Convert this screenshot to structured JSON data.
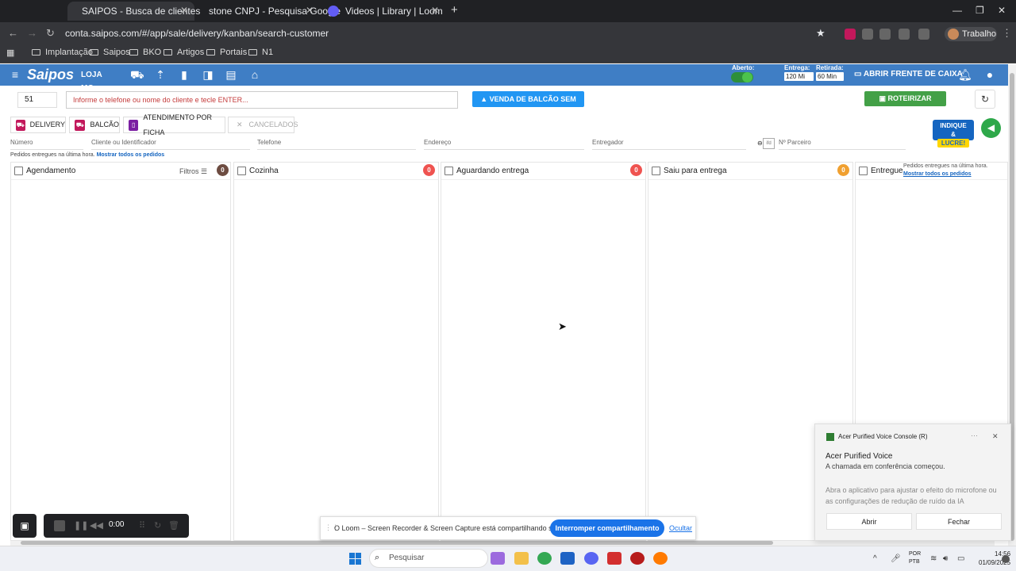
{
  "browser": {
    "tabs": [
      {
        "title": "SAIPOS - Busca de clientes",
        "active": true
      },
      {
        "title": "stone CNPJ - Pesquisa Google",
        "active": false
      },
      {
        "title": "Videos | Library | Loom",
        "active": false
      }
    ],
    "url": "conta.saipos.com/#/app/sale/delivery/kanban/search-customer",
    "profile": "Trabalho",
    "bookmarks": [
      "Implantação",
      "Saipos",
      "BKO",
      "Artigos",
      "Portais",
      "N1"
    ]
  },
  "app": {
    "logo": "Saipos",
    "store": "LOJA MO...",
    "aberto_label": "Aberto:",
    "entrega_label": "Entrega:",
    "entrega_value": "120 Mi",
    "retirada_label": "Retirada:",
    "retirada_value": "60 Min",
    "frente_caixa": "ABRIR FRENTE DE CAIXA"
  },
  "search": {
    "number": "51",
    "placeholder": "Informe o telefone ou nome do cliente e tecle ENTER...",
    "venda_balcao": "VENDA DE BALCÃO SEM CLIENTE",
    "roteirizar": "ROTEIRIZAR ENTREGA"
  },
  "order_tabs": [
    "DELIVERY",
    "BALCÃO",
    "ATENDIMENTO POR FICHA",
    "CANCELADOS"
  ],
  "promo": {
    "line1": "INDIQUE &",
    "line2": "LUCRE!"
  },
  "filters": {
    "numero": "Número",
    "cliente": "Cliente ou Identificador",
    "telefone": "Telefone",
    "endereco": "Endereço",
    "entregador": "Entregador",
    "parceiro": "Nº Parceiro"
  },
  "info": {
    "text": "Pedidos entregues na última hora.",
    "link": "Mostrar todos os pedidos"
  },
  "columns": [
    {
      "title": "Agendamento",
      "count": "0",
      "color": "#6d4c41"
    },
    {
      "title": "Cozinha",
      "count": "0",
      "color": "#ef5350"
    },
    {
      "title": "Aguardando entrega",
      "count": "0",
      "color": "#ef5350"
    },
    {
      "title": "Saiu para entrega",
      "count": "0",
      "color": "#f0a030"
    },
    {
      "title": "Entregue",
      "count": "",
      "color": ""
    }
  ],
  "filtros_label": "Filtros",
  "entregue_info": {
    "text": "Pedidos entregues na última hora.",
    "link": "Mostrar todos os pedidos"
  },
  "loom": {
    "time": "0:00",
    "share_text": "O Loom – Screen Recorder & Screen Capture está compartilhando sua tela.",
    "stop_button": "Interromper compartilhamento",
    "hide": "Ocultar"
  },
  "notification": {
    "app": "Acer Purified Voice Console (R)",
    "title": "Acer Purified Voice",
    "subtitle": "A chamada em conferência começou.",
    "body": "Abra o aplicativo para ajustar o efeito do microfone ou as configurações de redução de ruído da IA",
    "open": "Abrir",
    "close": "Fechar"
  },
  "taskbar": {
    "search": "Pesquisar",
    "lang1": "POR",
    "lang2": "PTB",
    "time": "14:56",
    "date": "01/09/2025"
  }
}
